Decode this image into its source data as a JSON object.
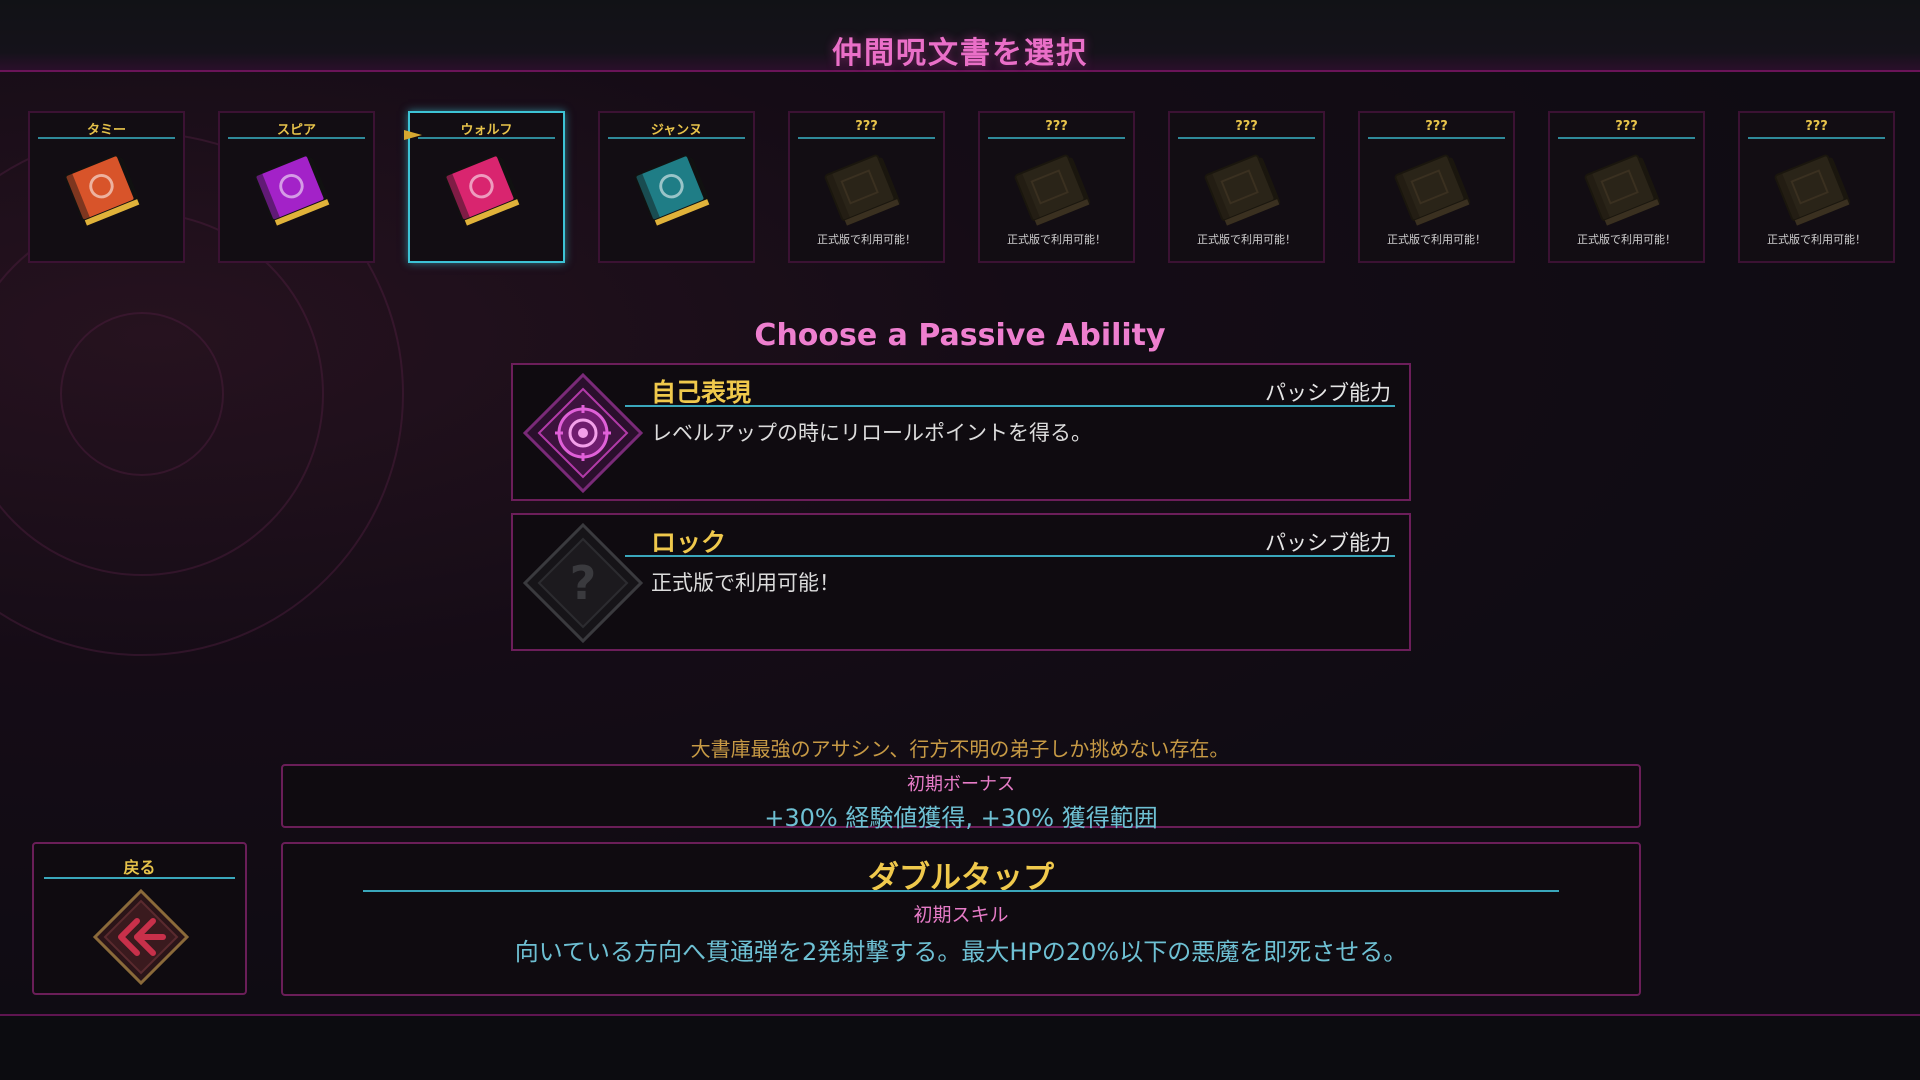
{
  "header": {
    "title": "仲間呪文書を選択"
  },
  "books": [
    {
      "name": "タミー",
      "locked": false,
      "selected": false,
      "icon": "tammy-book-icon",
      "color": "#d8542a"
    },
    {
      "name": "スピア",
      "locked": false,
      "selected": false,
      "icon": "spear-book-icon",
      "color": "#a322c8"
    },
    {
      "name": "ウォルフ",
      "locked": false,
      "selected": true,
      "icon": "wolf-book-icon",
      "color": "#d9256f"
    },
    {
      "name": "ジャンヌ",
      "locked": false,
      "selected": false,
      "icon": "jeanne-book-icon",
      "color": "#1f7d86"
    },
    {
      "name": "???",
      "locked": true,
      "selected": false,
      "icon": "locked-book-icon",
      "unavailable_text": "正式版で利用可能！"
    },
    {
      "name": "???",
      "locked": true,
      "selected": false,
      "icon": "locked-book-icon",
      "unavailable_text": "正式版で利用可能！"
    },
    {
      "name": "???",
      "locked": true,
      "selected": false,
      "icon": "locked-book-icon",
      "unavailable_text": "正式版で利用可能！"
    },
    {
      "name": "???",
      "locked": true,
      "selected": false,
      "icon": "locked-book-icon",
      "unavailable_text": "正式版で利用可能！"
    },
    {
      "name": "???",
      "locked": true,
      "selected": false,
      "icon": "locked-book-icon",
      "unavailable_text": "正式版で利用可能！"
    },
    {
      "name": "???",
      "locked": true,
      "selected": false,
      "icon": "locked-book-icon",
      "unavailable_text": "正式版で利用可能！"
    }
  ],
  "passive": {
    "title": "Choose a Passive Ability",
    "abilities": [
      {
        "name": "自己表現",
        "type": "パッシブ能力",
        "description": "レベルアップの時にリロールポイントを得る。",
        "icon": "sun-gear-icon",
        "locked": false
      },
      {
        "name": "ロック",
        "type": "パッシブ能力",
        "description": "正式版で利用可能！",
        "icon": "question-mark-icon",
        "locked": true
      }
    ]
  },
  "lore": "大書庫最強のアサシン、行方不明の弟子しか挑めない存在。",
  "bonus": {
    "label": "初期ボーナス",
    "text": "+30% 経験値獲得, +30% 獲得範囲"
  },
  "back": {
    "label": "戻る",
    "icon": "back-arrow-icon"
  },
  "skill": {
    "name": "ダブルタップ",
    "label": "初期スキル",
    "description": "向いている方向へ貫通弾を2発射撃する。最大HPの20%以下の悪魔を即死させる。"
  },
  "colors": {
    "accent_pink": "#ea6fc8",
    "gold": "#f0c94c",
    "cyan": "#3aa7bb",
    "selected_border": "#3dc3d6"
  }
}
